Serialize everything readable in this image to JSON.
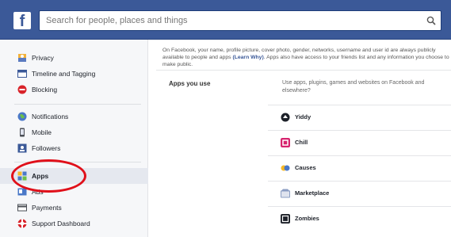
{
  "header": {
    "logo": "f",
    "search_placeholder": "Search for people, places and things",
    "brand_color": "#3b5998"
  },
  "sidebar": {
    "group1": [
      {
        "label": "Privacy",
        "icon": "privacy-lock-icon"
      },
      {
        "label": "Timeline and Tagging",
        "icon": "timeline-icon"
      },
      {
        "label": "Blocking",
        "icon": "blocking-icon"
      }
    ],
    "group2": [
      {
        "label": "Notifications",
        "icon": "globe-icon"
      },
      {
        "label": "Mobile",
        "icon": "mobile-icon"
      },
      {
        "label": "Followers",
        "icon": "followers-icon"
      }
    ],
    "group3": [
      {
        "label": "Apps",
        "icon": "apps-icon",
        "active": true
      },
      {
        "label": "Ads",
        "icon": "ads-icon"
      },
      {
        "label": "Payments",
        "icon": "payments-icon"
      },
      {
        "label": "Support Dashboard",
        "icon": "support-icon"
      }
    ],
    "highlight_color": "#e0101a"
  },
  "main": {
    "intro_text": "On Facebook, your name, profile picture, cover photo, gender, networks, username and user id are always publicly available to people and",
    "intro_text2": "apps",
    "intro_link": "(Learn Why)",
    "intro_text3": ". Apps also have access to your friends list and any information you choose to make public.",
    "apps_section": {
      "label": "Apps you use",
      "description": "Use apps, plugins, games and websites on Facebook and elsewhere?"
    },
    "apps": [
      {
        "name": "Yiddy",
        "icon": "yiddy-icon"
      },
      {
        "name": "Chill",
        "icon": "chill-icon"
      },
      {
        "name": "Causes",
        "icon": "causes-icon"
      },
      {
        "name": "Marketplace",
        "icon": "marketplace-icon"
      },
      {
        "name": "Zombies",
        "icon": "zombies-icon"
      }
    ]
  }
}
